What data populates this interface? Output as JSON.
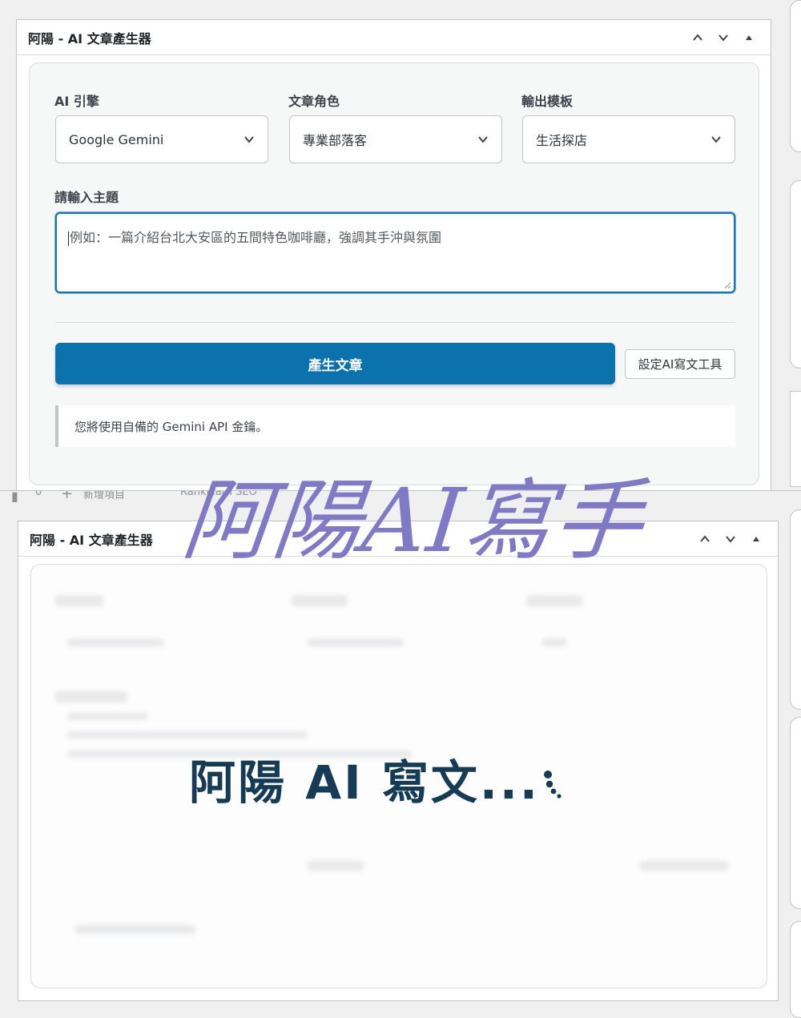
{
  "panel_top": {
    "title": "阿陽 - AI 文章產生器",
    "fields": {
      "engine_label": "AI 引擎",
      "engine_value": "Google Gemini",
      "role_label": "文章角色",
      "role_value": "專業部落客",
      "template_label": "輸出模板",
      "template_value": "生活探店"
    },
    "topic_label": "請輸入主題",
    "topic_placeholder": "例如：一篇介紹台北大安區的五間特色咖啡廳，強調其手沖與氛圍",
    "generate_button": "產生文章",
    "settings_button": "設定AI寫文工具",
    "notice": "您將使用自備的 Gemini API 金鑰。"
  },
  "admin_bar": {
    "comments_count": "0",
    "new_item": "新增項目",
    "other_item": "RankMath SEO"
  },
  "watermark": "阿陽AI寫手",
  "panel_bottom": {
    "title": "阿陽 - AI 文章產生器",
    "loading_text": "阿陽 AI 寫文..."
  },
  "icons": {
    "collapse_up": "chevron-up-icon",
    "collapse_down": "chevron-down-icon",
    "toggle": "triangle-up-icon",
    "select_arrow": "chevron-down-icon",
    "comment": "comment-icon",
    "plus": "plus-icon"
  }
}
